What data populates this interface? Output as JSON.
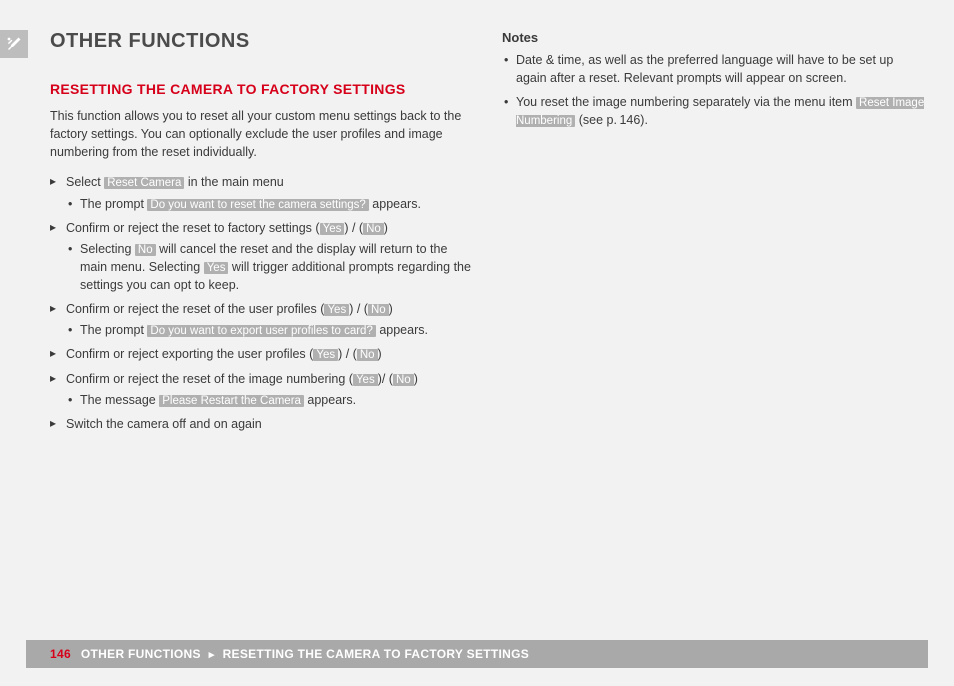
{
  "sideIcon": "tools-icon",
  "title": "OTHER FUNCTIONS",
  "sectionTitle": "RESETTING THE CAMERA TO FACTORY SETTINGS",
  "intro": "This function allows you to reset all your custom menu settings back to the factory settings. You can optionally exclude the user profiles and image numbering from the reset individually.",
  "steps": {
    "s1_a": "Select ",
    "s1_label": "Reset Camera",
    "s1_b": " in the main menu",
    "s1_sub_a": "The prompt ",
    "s1_sub_label": "Do you want to reset the camera settings?",
    "s1_sub_b": " appears.",
    "s2_a": "Confirm or reject the reset to factory settings (",
    "s2_yes": "Yes",
    "s2_mid": ") / (",
    "s2_no": "No",
    "s2_b": ")",
    "s2_sub_a": "Selecting ",
    "s2_sub_no": "No",
    "s2_sub_b": " will cancel the reset and the display will return to the main menu. Selecting ",
    "s2_sub_yes": "Yes",
    "s2_sub_c": " will trigger additional prompts regarding the settings you can opt to keep.",
    "s3_a": "Confirm or reject the reset of the user profiles (",
    "s3_yes": "Yes",
    "s3_mid": ") / (",
    "s3_no": "No",
    "s3_b": ")",
    "s3_sub_a": "The prompt ",
    "s3_sub_label": "Do you want to export user profiles to card?",
    "s3_sub_b": " appears.",
    "s4_a": "Confirm or reject exporting the user profiles (",
    "s4_yes": "Yes",
    "s4_mid": ") / (",
    "s4_no": "No",
    "s4_b": ")",
    "s5_a": "Confirm or reject the reset of the image numbering (",
    "s5_yes": "Yes",
    "s5_mid": ")/ (",
    "s5_no": "No",
    "s5_b": ")",
    "s5_sub_a": "The message ",
    "s5_sub_label": "Please Restart the Camera",
    "s5_sub_b": " appears.",
    "s6": "Switch the camera off and on again"
  },
  "notes": {
    "title": "Notes",
    "n1": "Date & time, as well as the preferred language will have to be set up again after a reset. Relevant prompts will appear on screen.",
    "n2_a": "You reset the image numbering separately via the menu item ",
    "n2_label": "Reset Image Numbering",
    "n2_b": " (see p. 146)."
  },
  "footer": {
    "pageNum": "146",
    "crumb1": "OTHER FUNCTIONS",
    "sep": "▸",
    "crumb2": "RESETTING THE CAMERA TO FACTORY SETTINGS"
  }
}
